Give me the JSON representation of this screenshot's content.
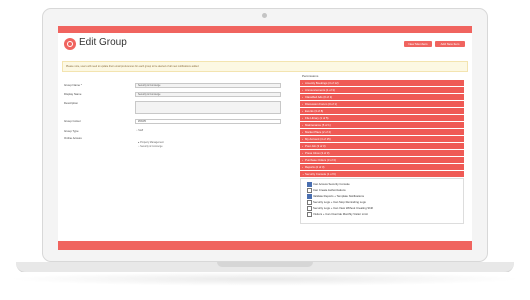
{
  "header": {
    "title": "Edit Group",
    "btn_new_member": "New Members",
    "btn_add_new": "Add New Item"
  },
  "notice": "Please note, users will need to update their email preferences for each group to be alerted of all new notifications added",
  "form": {
    "group_name_label": "Group Name *",
    "group_name_value": "Security & Concierge",
    "display_name_label": "Display Name",
    "display_name_value": "Security & Concierge",
    "description_label": "Description",
    "group_colour_label": "Group Colour",
    "group_colour_value": "#f0645f",
    "group_type_label": "Group Type",
    "group_type_value": "Staff",
    "online_access_label": "Online Access",
    "online_access_opt1": "Property Management",
    "online_access_opt2": "Security & Concierge"
  },
  "permissions": {
    "title": "Permissions",
    "rows": [
      "Amenity Bookings (3 of 12)",
      "Announcements (1 of 3)",
      "Classified Ads (0 of 1)",
      "Discussion Forum (0 of 1)",
      "Events (3 of 8)",
      "File Library (1 of 5)",
      "Maintenance (5 of 1)",
      "Market Place (2 of 2)",
      "My Account (4 of 15)",
      "Post Job (3 of 3)",
      "Press Inbox (3 of 3)",
      "Purchase Orders (3 of 3)",
      "Reports (2 of 3)",
      "Security Console (1 of 6)"
    ],
    "checks": [
      {
        "label": "Can Access Security Console",
        "on": true
      },
      {
        "label": "Can Create Authorizations",
        "on": false
      },
      {
        "label": "Validate Reports + Template Notifications",
        "on": true
      },
      {
        "label": "Security Logs + Can Stop Reminding Logs",
        "on": false
      },
      {
        "label": "Security Logs + Can View Without Creating Shift",
        "on": false
      },
      {
        "label": "Visitors + Can Override Monthly Visitor Limit",
        "on": false
      }
    ]
  }
}
